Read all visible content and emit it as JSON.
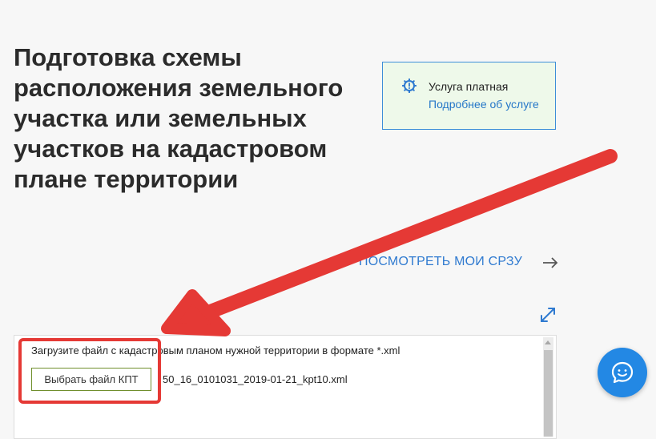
{
  "page": {
    "title": "Подготовка схемы расположения земельного участка или земельных участков на кадастровом плане территории"
  },
  "service_info": {
    "icon": "gear-icon",
    "paid_label": "Услуга платная",
    "details_link": "Подробнее об услуге"
  },
  "view_link": {
    "label": "ПОСМОТРЕТЬ МОИ СРЗУ",
    "icon": "arrow-right-icon"
  },
  "expand_icon": "expand-icon",
  "upload": {
    "hint": "Загрузите файл с кадастровым планом нужной территории в формате *.xml",
    "button_label": "Выбрать файл КПТ",
    "file_name": "50_16_0101031_2019-01-21_kpt10.xml"
  },
  "chat": {
    "icon": "chat-icon"
  },
  "colors": {
    "accent": "#2f7ad0",
    "highlight": "#e53935",
    "info_bg": "#eef9ea",
    "chat": "#2388e4"
  }
}
